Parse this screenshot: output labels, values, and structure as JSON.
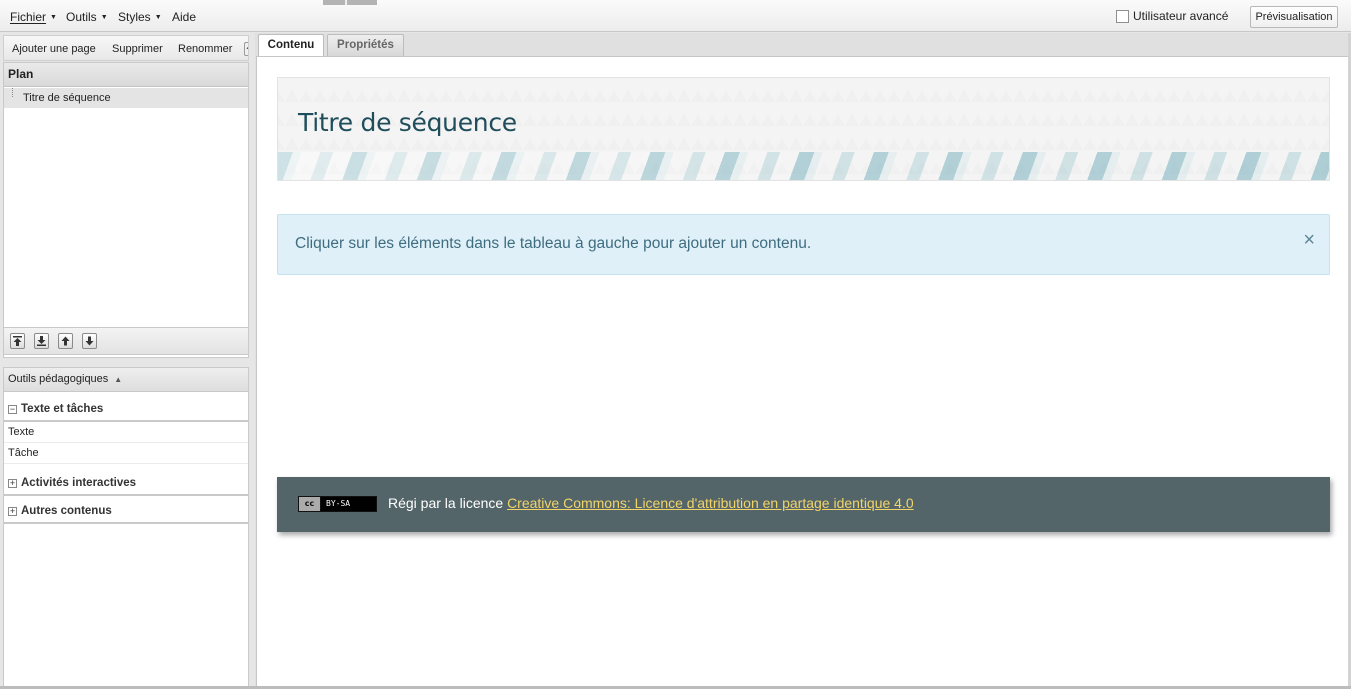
{
  "menubar": {
    "items": [
      {
        "label": "Fichier"
      },
      {
        "label": "Outils"
      },
      {
        "label": "Styles"
      },
      {
        "label": "Aide"
      }
    ],
    "advanced_user_label": "Utilisateur avancé",
    "advanced_user_checked": false,
    "preview_label": "Prévisualisation"
  },
  "page_toolbar": {
    "add_label": "Ajouter une page",
    "delete_label": "Supprimer",
    "rename_label": "Renommer"
  },
  "plan": {
    "header": "Plan",
    "items": [
      {
        "label": "Titre de séquence",
        "selected": true
      }
    ],
    "controls": [
      "move-top-icon",
      "move-bottom-icon",
      "move-up-icon",
      "move-down-icon"
    ]
  },
  "tools": {
    "header": "Outils pédagogiques",
    "groups": [
      {
        "title": "Texte et tâches",
        "expanded": true,
        "items": [
          "Texte",
          "Tâche"
        ]
      },
      {
        "title": "Activités interactives",
        "expanded": false,
        "items": []
      },
      {
        "title": "Autres contenus",
        "expanded": false,
        "items": []
      }
    ]
  },
  "tabs": {
    "content": "Contenu",
    "properties": "Propriétés",
    "active": "content"
  },
  "content": {
    "sequence_title": "Titre de séquence",
    "info_message": "Cliquer sur les éléments dans le tableau à gauche pour ajouter un contenu.",
    "close_glyph": "×",
    "license": {
      "badge_cc": "cc",
      "badge_terms": "BY-SA",
      "prefix": "Régi par la licence ",
      "link_text": "Creative Commons: Licence d'attribution en partage identique 4.0"
    }
  },
  "colors": {
    "license_bar": "#536569",
    "license_link": "#f1d36a",
    "info_bg": "#e0f0f8",
    "title_color": "#1f4d5b"
  }
}
